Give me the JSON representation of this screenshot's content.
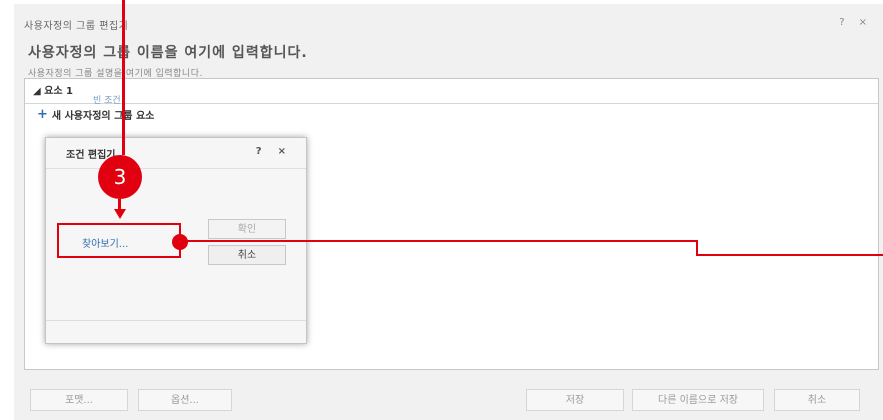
{
  "editor": {
    "title": "사용자정의 그룹 편집기",
    "help": "?",
    "close": "×",
    "group_name": "사용자정의 그룹 이름을 여기에 입력합니다.",
    "group_desc": "사용자정의 그룹 설명을 여기에 입력합니다.",
    "element_title": "◢ 요소 1",
    "element_condition": "빈 조건",
    "add_element": "새 사용자정의 그룹 요소"
  },
  "dialog": {
    "title": "조건 편집기",
    "help": "?",
    "close": "×",
    "browse": "찾아보기...",
    "ok": "확인",
    "cancel": "취소"
  },
  "footer": {
    "format": "포맷...",
    "options": "옵션...",
    "save": "저장",
    "save_as": "다른 이름으로 저장",
    "cancel": "취소"
  },
  "annotation": {
    "step": "3",
    "color": "#e1000f"
  },
  "icons": [
    "plus-icon",
    "help-icon",
    "close-icon",
    "collapse-triangle-icon"
  ]
}
